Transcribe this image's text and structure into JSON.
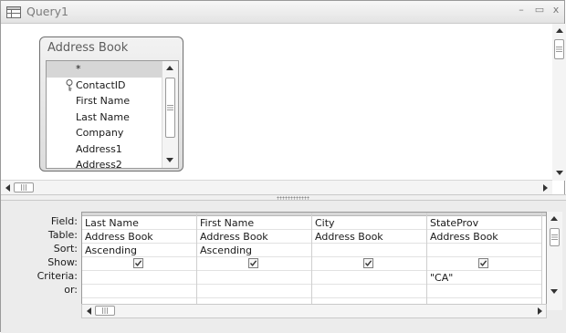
{
  "window": {
    "title": "Query1",
    "minimize": "–",
    "maximize": "▭",
    "close": "x",
    "icon": "query-icon"
  },
  "field_list": {
    "title": "Address Book",
    "items": [
      {
        "label": "*",
        "selected": true,
        "key": false
      },
      {
        "label": "ContactID",
        "selected": false,
        "key": true
      },
      {
        "label": "First Name",
        "selected": false,
        "key": false
      },
      {
        "label": "Last Name",
        "selected": false,
        "key": false
      },
      {
        "label": "Company",
        "selected": false,
        "key": false
      },
      {
        "label": "Address1",
        "selected": false,
        "key": false
      },
      {
        "label": "Address2",
        "selected": false,
        "key": false
      }
    ]
  },
  "grid": {
    "row_labels": [
      "Field:",
      "Table:",
      "Sort:",
      "Show:",
      "Criteria:",
      "or:"
    ],
    "columns": [
      {
        "field": "Last Name",
        "table": "Address Book",
        "sort": "Ascending",
        "show": true,
        "criteria": "",
        "or": ""
      },
      {
        "field": "First Name",
        "table": "Address Book",
        "sort": "Ascending",
        "show": true,
        "criteria": "",
        "or": ""
      },
      {
        "field": "City",
        "table": "Address Book",
        "sort": "",
        "show": true,
        "criteria": "",
        "or": ""
      },
      {
        "field": "StateProv",
        "table": "Address Book",
        "sort": "",
        "show": true,
        "criteria": "\"CA\"",
        "or": ""
      }
    ]
  }
}
